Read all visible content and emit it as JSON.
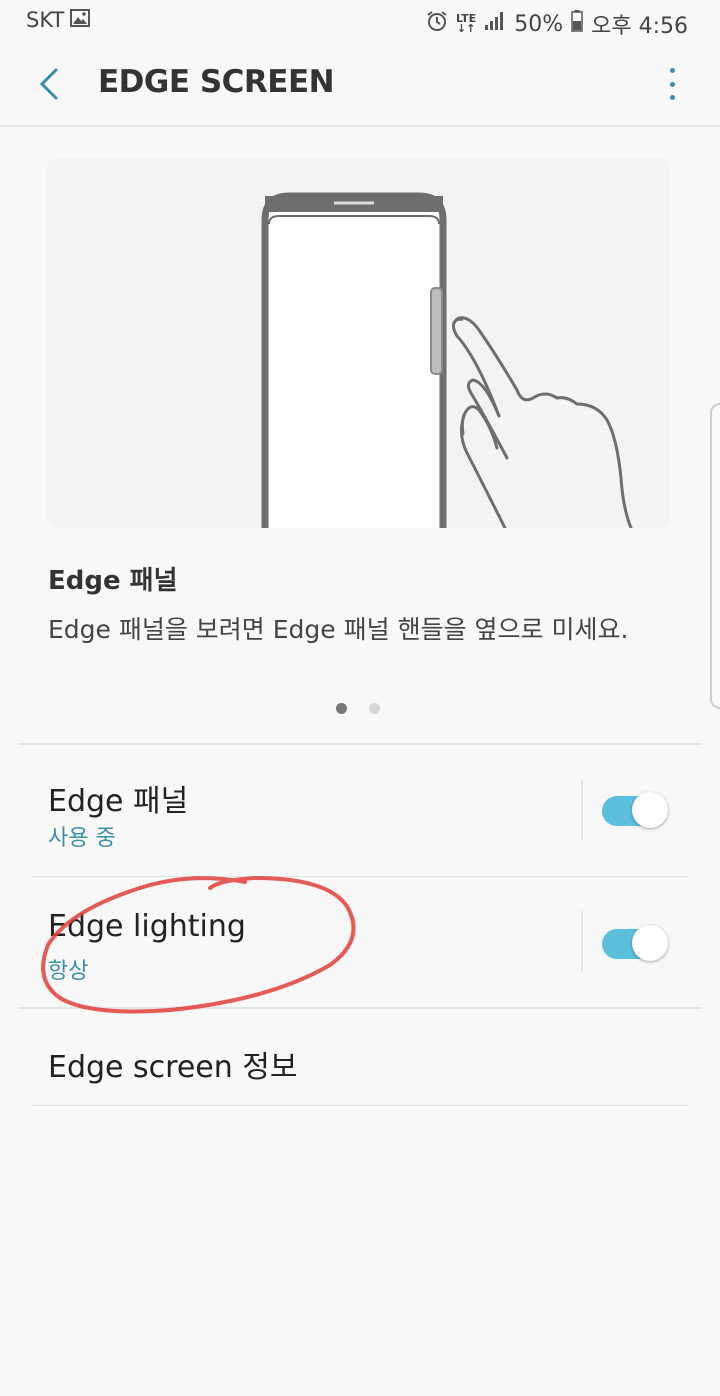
{
  "status_bar": {
    "carrier": "SKT",
    "network": "LTE",
    "battery": "50%",
    "time": "오후 4:56",
    "icons": [
      "gallery-icon",
      "alarm-icon",
      "signal-icon",
      "battery-icon"
    ]
  },
  "header": {
    "title": "EDGE SCREEN",
    "back_icon": "back-arrow-icon",
    "more_icon": "more-vert-icon"
  },
  "info": {
    "title": "Edge 패널",
    "description": "Edge 패널을 보려면 Edge 패널 핸들을 옆으로 미세요.",
    "page_count": 2,
    "active_page": 1
  },
  "settings": [
    {
      "title": "Edge 패널",
      "subtitle": "사용 중",
      "enabled": true
    },
    {
      "title": "Edge lighting",
      "subtitle": "항상",
      "enabled": true
    },
    {
      "title": "Edge screen 정보"
    }
  ],
  "colors": {
    "accent": "#3a8fa8",
    "toggle_on": "#5bc0de",
    "annotation": "#e0403a"
  }
}
